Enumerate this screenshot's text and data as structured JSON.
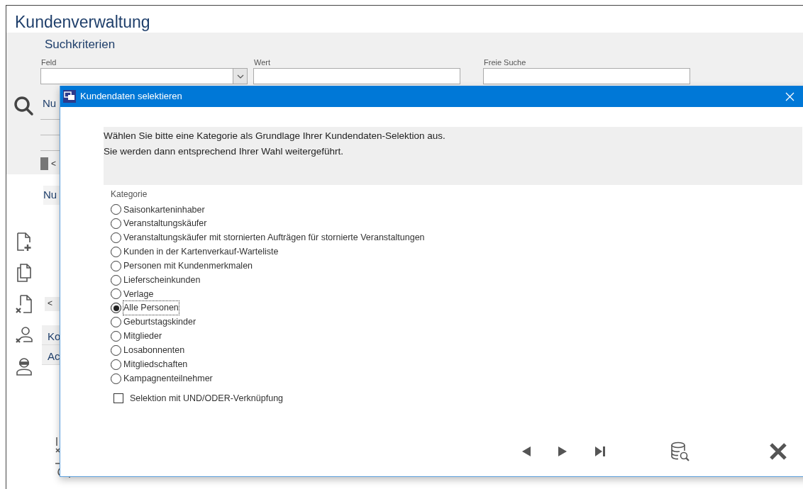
{
  "app": {
    "title": "Kundenverwaltung",
    "search_panel": {
      "title": "Suchkriterien",
      "fields": [
        {
          "label": "Feld",
          "kind": "dropdown"
        },
        {
          "label": "Wert",
          "kind": "text"
        },
        {
          "label": "Freie Suche",
          "kind": "text"
        }
      ]
    },
    "grid_header_fragment": "Nu",
    "scroll_left_top": "<",
    "list_header_fragment": "Nu",
    "scroll_left_bottom": "<",
    "tabs": [
      {
        "label": "Ko"
      },
      {
        "label": "Ac"
      }
    ]
  },
  "dialog": {
    "title": "Kundendaten selektieren",
    "message": [
      "Wählen Sie bitte eine Kategorie als Grundlage Ihrer Kundendaten-Selektion aus.",
      "Sie werden dann entsprechend Ihrer Wahl weitergeführt."
    ],
    "category_label": "Kategorie",
    "categories": [
      {
        "label": "Saisonkarteninhaber",
        "selected": false
      },
      {
        "label": "Veranstaltungskäufer",
        "selected": false
      },
      {
        "label": "Veranstaltungskäufer mit stornierten Aufträgen für stornierte Veranstaltungen",
        "selected": false
      },
      {
        "label": "Kunden in der Kartenverkauf-Warteliste",
        "selected": false
      },
      {
        "label": "Personen mit Kundenmerkmalen",
        "selected": false
      },
      {
        "label": "Lieferscheinkunden",
        "selected": false
      },
      {
        "label": "Verlage",
        "selected": false
      },
      {
        "label": "Alle Personen",
        "selected": true
      },
      {
        "label": "Geburtstagskinder",
        "selected": false
      },
      {
        "label": "Mitglieder",
        "selected": false
      },
      {
        "label": "Losabonnenten",
        "selected": false
      },
      {
        "label": "Mitgliedschaften",
        "selected": false
      },
      {
        "label": "Kampagnenteilnehmer",
        "selected": false
      }
    ],
    "option": {
      "label": "Selektion mit UND/ODER-Verknüpfung",
      "checked": false
    }
  }
}
